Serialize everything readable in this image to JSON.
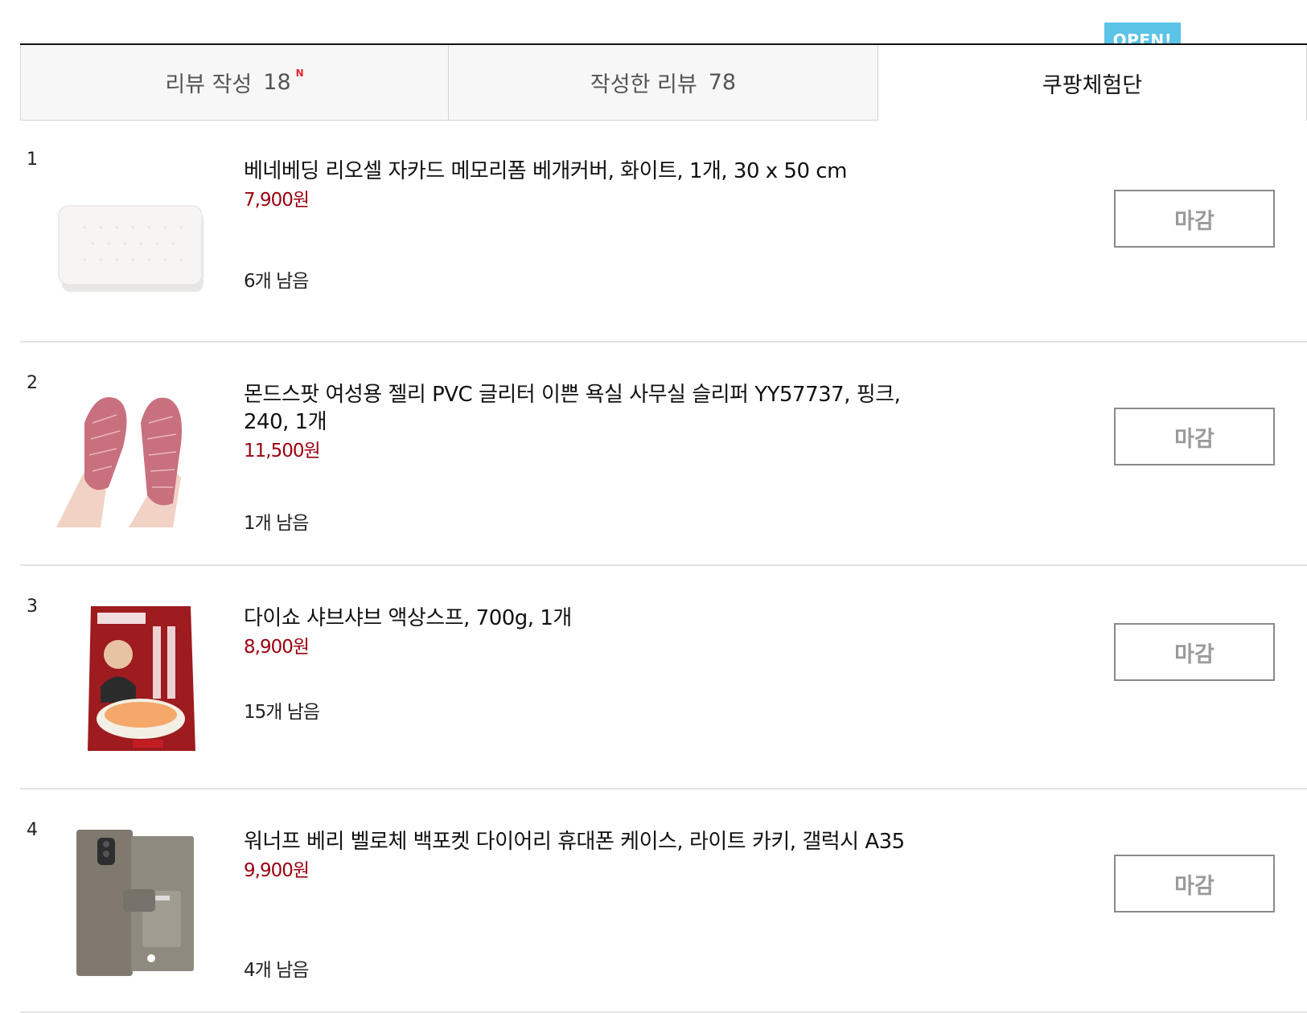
{
  "tabs": [
    {
      "label": "리뷰 작성",
      "count": "18",
      "badge": "N"
    },
    {
      "label": "작성한 리뷰",
      "count": "78"
    },
    {
      "label": "쿠팡체험단",
      "ribbon": "OPEN!"
    }
  ],
  "items": [
    {
      "num": "1",
      "title": "베네베딩 리오셀 자카드 메모리폼 베개커버, 화이트, 1개, 30 x 50 cm",
      "price": "7,900원",
      "remaining": "6개 남음",
      "button": "마감",
      "thumb_icon": "pillow-image"
    },
    {
      "num": "2",
      "title": "몬드스팟 여성용 젤리 PVC 글리터 이쁜 욕실 사무실 슬리퍼 YY57737, 핑크, 240, 1개",
      "price": "11,500원",
      "remaining": "1개 남음",
      "button": "마감",
      "thumb_icon": "slipper-image"
    },
    {
      "num": "3",
      "title": "다이쇼 샤브샤브 액상스프, 700g, 1개",
      "price": "8,900원",
      "remaining": "15개 남음",
      "button": "마감",
      "thumb_icon": "soup-package-image"
    },
    {
      "num": "4",
      "title": "워너프 베리 벨로체 백포켓 다이어리 휴대폰 케이스, 라이트 카키, 갤럭시 A35",
      "price": "9,900원",
      "remaining": "4개 남음",
      "button": "마감",
      "thumb_icon": "phone-case-image"
    }
  ],
  "colors": {
    "price": "#9a0010",
    "ribbon": "#5bc3e6",
    "badge": "#e0282e"
  }
}
